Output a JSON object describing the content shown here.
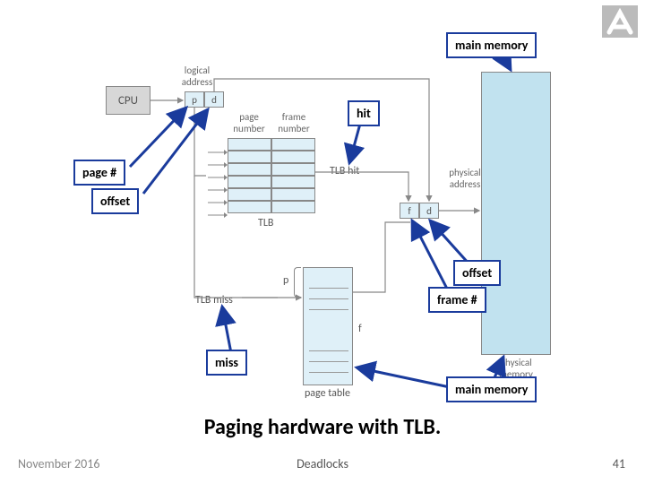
{
  "logo": {
    "name": "institution-logo"
  },
  "diagram": {
    "cpu": "CPU",
    "logical_address_label": "logical\naddress",
    "p": "p",
    "d": "d",
    "page_number_label": "page\nnumber",
    "frame_number_label": "frame\nnumber",
    "tlb_label": "TLB",
    "tlb_hit_label": "TLB hit",
    "tlb_miss_label": "TLB miss",
    "f": "f",
    "physical_address_label": "physical\naddress",
    "physical_memory_label": "physical\nmemory",
    "page_table_label": "page table"
  },
  "callouts": {
    "main_memory_top": "main memory",
    "hit": "hit",
    "page_num": "page #",
    "offset_left": "offset",
    "offset_right": "offset",
    "frame_num": "frame #",
    "miss": "miss",
    "main_memory_bottom": "main memory"
  },
  "caption": "Paging hardware with TLB.",
  "footer": {
    "date": "November 2016",
    "topic": "Deadlocks",
    "page": "41"
  }
}
